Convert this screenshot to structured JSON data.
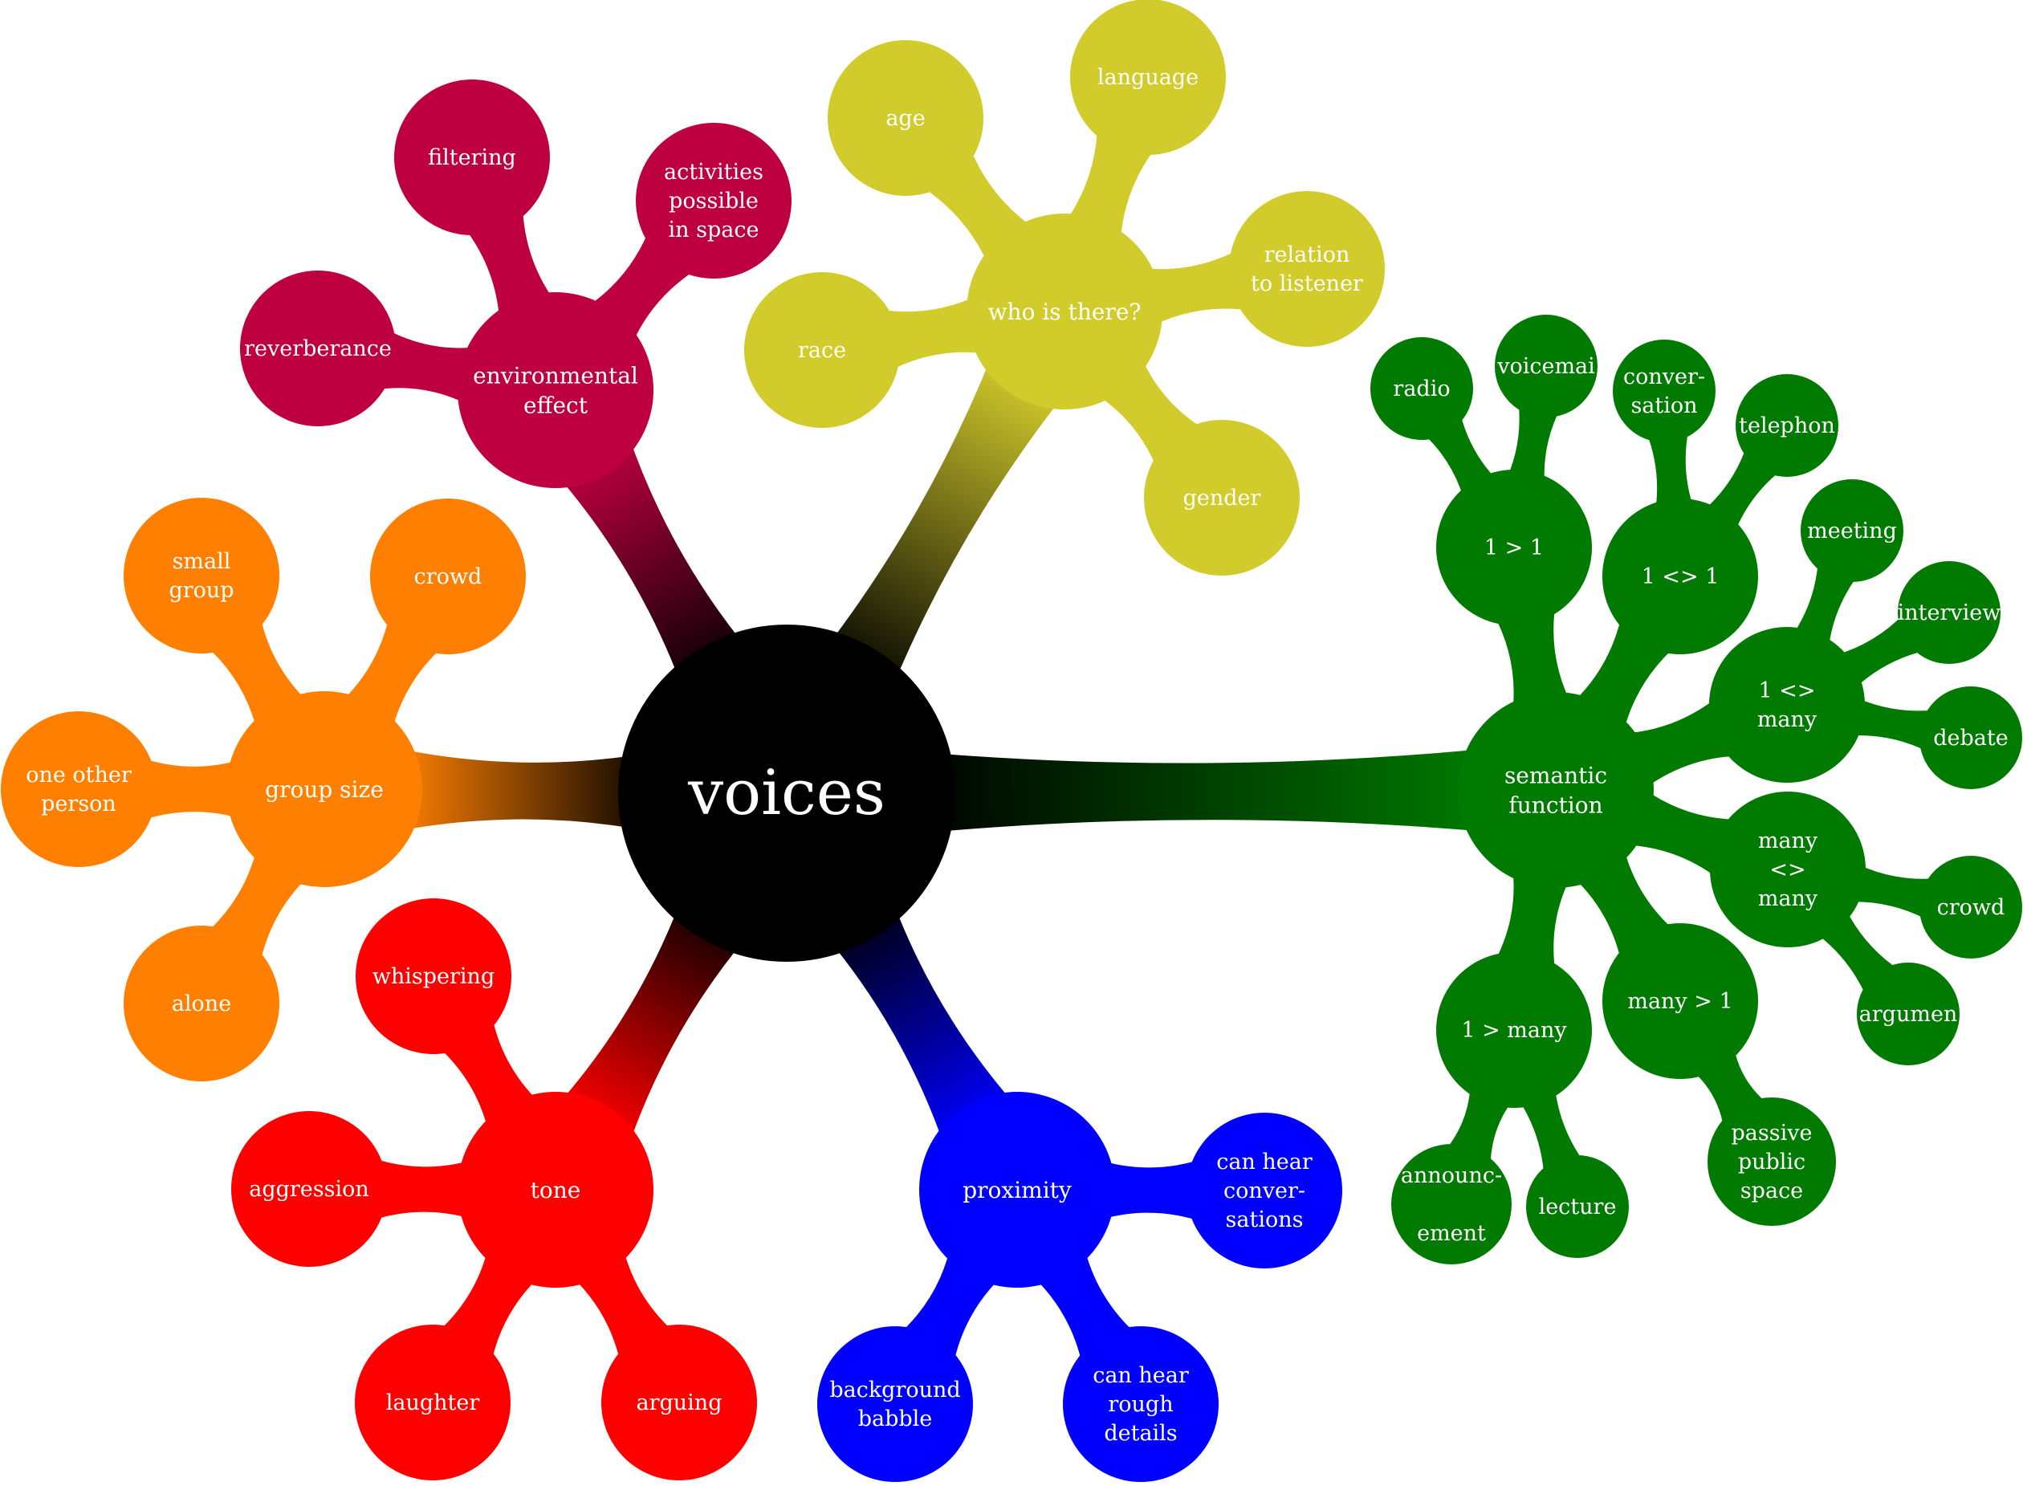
{
  "root": {
    "label": "voices",
    "color": "#000000"
  },
  "branches": [
    {
      "id": "environmental-effect",
      "lines": [
        "environmental",
        "effect"
      ],
      "color": "#bf0040",
      "children": [
        {
          "id": "filtering",
          "lines": [
            "filtering"
          ]
        },
        {
          "id": "activities-possible-in-space",
          "lines": [
            "activities",
            "possible",
            "in space"
          ]
        },
        {
          "id": "reverberance",
          "lines": [
            "reverberance"
          ]
        }
      ]
    },
    {
      "id": "who-is-there",
      "lines": [
        "who is there?"
      ],
      "color": "#d2cb2c",
      "children": [
        {
          "id": "age",
          "lines": [
            "age"
          ]
        },
        {
          "id": "language",
          "lines": [
            "language"
          ]
        },
        {
          "id": "relation-to-listener",
          "lines": [
            "relation",
            "to listener"
          ]
        },
        {
          "id": "race",
          "lines": [
            "race"
          ]
        },
        {
          "id": "gender",
          "lines": [
            "gender"
          ]
        }
      ]
    },
    {
      "id": "group-size",
      "lines": [
        "group size"
      ],
      "color": "#ff8000",
      "children": [
        {
          "id": "small-group",
          "lines": [
            "small",
            "group"
          ]
        },
        {
          "id": "crowd",
          "lines": [
            "crowd"
          ]
        },
        {
          "id": "one-other-person",
          "lines": [
            "one other",
            "person"
          ]
        },
        {
          "id": "alone",
          "lines": [
            "alone"
          ]
        }
      ]
    },
    {
      "id": "tone",
      "lines": [
        "tone"
      ],
      "color": "#ff0000",
      "children": [
        {
          "id": "whispering",
          "lines": [
            "whispering"
          ]
        },
        {
          "id": "aggression",
          "lines": [
            "aggression"
          ]
        },
        {
          "id": "laughter",
          "lines": [
            "laughter"
          ]
        },
        {
          "id": "arguing",
          "lines": [
            "arguing"
          ]
        }
      ]
    },
    {
      "id": "proximity",
      "lines": [
        "proximity"
      ],
      "color": "#0000ff",
      "children": [
        {
          "id": "can-hear-conversations",
          "lines": [
            "can hear",
            "conver-",
            "sations"
          ]
        },
        {
          "id": "background-babble",
          "lines": [
            "background",
            "babble"
          ]
        },
        {
          "id": "can-hear-rough-details",
          "lines": [
            "can hear",
            "rough",
            "details"
          ]
        }
      ]
    },
    {
      "id": "semantic-function",
      "lines": [
        "semantic",
        "function"
      ],
      "color": "#007a00",
      "children": [
        {
          "id": "one-to-one",
          "lines": [
            "1 > 1"
          ],
          "children": [
            {
              "id": "radio",
              "lines": [
                "radio"
              ]
            },
            {
              "id": "voicemail",
              "lines": [
                "voicemai"
              ]
            }
          ]
        },
        {
          "id": "one-with-one",
          "lines": [
            "1 <> 1"
          ],
          "children": [
            {
              "id": "conversation",
              "lines": [
                "conver-",
                "sation"
              ]
            },
            {
              "id": "telephone",
              "lines": [
                "telephon"
              ]
            }
          ]
        },
        {
          "id": "one-with-many",
          "lines": [
            "1 <>",
            "many"
          ],
          "children": [
            {
              "id": "meeting",
              "lines": [
                "meeting"
              ]
            },
            {
              "id": "interview",
              "lines": [
                "interview"
              ]
            },
            {
              "id": "debate",
              "lines": [
                "debate"
              ]
            }
          ]
        },
        {
          "id": "many-with-many",
          "lines": [
            "many",
            "<>",
            "many"
          ],
          "children": [
            {
              "id": "crowd-2",
              "lines": [
                "crowd"
              ]
            },
            {
              "id": "argument",
              "lines": [
                "argumen"
              ]
            }
          ]
        },
        {
          "id": "many-to-one",
          "lines": [
            "many > 1"
          ],
          "children": [
            {
              "id": "passive-public-space",
              "lines": [
                "passive",
                "public",
                "space"
              ]
            }
          ]
        },
        {
          "id": "one-to-many",
          "lines": [
            "1 > many"
          ],
          "children": [
            {
              "id": "announcement",
              "lines": [
                "announc-",
                "",
                "ement"
              ]
            },
            {
              "id": "lecture",
              "lines": [
                "lecture"
              ]
            }
          ]
        }
      ]
    }
  ]
}
